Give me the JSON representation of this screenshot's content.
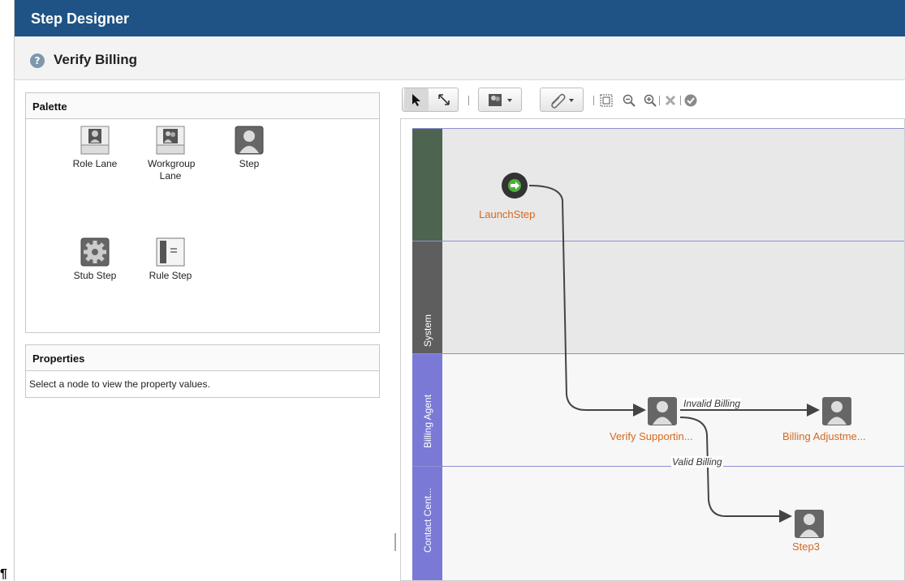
{
  "window": {
    "title": "Step Designer"
  },
  "header": {
    "page_title": "Verify Billing",
    "help_glyph": "?"
  },
  "palette": {
    "title": "Palette",
    "items": [
      {
        "label": "Role Lane",
        "icon": "role-lane-icon"
      },
      {
        "label": "Workgroup Lane",
        "icon": "workgroup-lane-icon"
      },
      {
        "label": "Step",
        "icon": "step-icon"
      },
      {
        "label": "Stub Step",
        "icon": "stub-step-icon"
      },
      {
        "label": "Rule Step",
        "icon": "rule-step-icon"
      }
    ]
  },
  "properties": {
    "title": "Properties",
    "message": "Select a node to view the property values."
  },
  "toolbar": {
    "tools": [
      "select-arrow-icon",
      "connect-arrow-icon",
      "lane-dropdown-icon",
      "attachment-dropdown-icon",
      "fit-to-view-icon",
      "zoom-out-icon",
      "zoom-in-icon",
      "delete-icon",
      "validate-icon"
    ]
  },
  "diagram": {
    "lanes": [
      {
        "label": "",
        "color": "#4d6450"
      },
      {
        "label": "System",
        "color": "#5e5e5e"
      },
      {
        "label": "Billing Agent",
        "color": "#7a7ad6"
      },
      {
        "label": "Contact Cent...",
        "color": "#7a7ad6"
      }
    ],
    "nodes": {
      "launch": "LaunchStep",
      "verify": "Verify Supportin...",
      "adjust": "Billing Adjustme...",
      "step3": "Step3"
    },
    "edges": {
      "invalid": "Invalid Billing",
      "valid": "Valid Billing"
    },
    "colors": {
      "node_label": "#d2691e",
      "lane_border": "#8f8fd0",
      "title_bar": "#1f5385"
    }
  },
  "misc": {
    "bottom_glyph": "¶"
  }
}
